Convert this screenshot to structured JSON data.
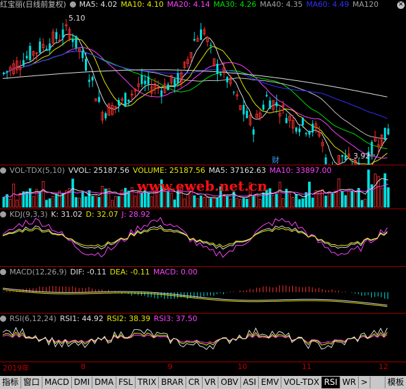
{
  "main": {
    "title": "红宝丽(日线前复权)",
    "ma": [
      {
        "label": "MA5: 4.02",
        "color": "#e0e0e0"
      },
      {
        "label": "MA10: 4.10",
        "color": "#e8e800"
      },
      {
        "label": "MA20: 4.14",
        "color": "#ff40ff"
      },
      {
        "label": "MA30: 4.26",
        "color": "#00e000"
      },
      {
        "label": "MA40: 4.35",
        "color": "#c0c0c0"
      },
      {
        "label": "MA60: 4.49",
        "color": "#3030ff"
      },
      {
        "label": "MA120",
        "color": "#c0c0c0"
      }
    ],
    "high_label": "5.10",
    "low_label": "3.92",
    "cai_label": "财"
  },
  "volume": {
    "items": [
      {
        "label": "VOL-TDX(5,10)",
        "color": "#c0c0c0"
      },
      {
        "label": "VVOL: 25187.56",
        "color": "#e0e0e0"
      },
      {
        "label": "VOLUME: 25187.56",
        "color": "#e8e800"
      },
      {
        "label": "MA5: 37162.63",
        "color": "#e0e0e0"
      },
      {
        "label": "MA10: 33897.00",
        "color": "#ff40ff"
      }
    ]
  },
  "watermark": "www.eweb.net.cn",
  "kdj": {
    "items": [
      {
        "label": "KDJ(9,3,3)",
        "color": "#c0c0c0"
      },
      {
        "label": "K: 31.02",
        "color": "#e0e0e0"
      },
      {
        "label": "D: 32.07",
        "color": "#e8e800"
      },
      {
        "label": "J: 28.92",
        "color": "#ff40ff"
      }
    ]
  },
  "macd": {
    "items": [
      {
        "label": "MACD(12,26,9)",
        "color": "#c0c0c0"
      },
      {
        "label": "DIF: -0.11",
        "color": "#e0e0e0"
      },
      {
        "label": "DEA: -0.11",
        "color": "#e8e800"
      },
      {
        "label": "MACD: 0.00",
        "color": "#ff40ff"
      }
    ]
  },
  "rsi": {
    "items": [
      {
        "label": "RSI(6,12,24)",
        "color": "#c0c0c0"
      },
      {
        "label": "RSI1: 44.92",
        "color": "#e0e0e0"
      },
      {
        "label": "RSI2: 38.39",
        "color": "#e8e800"
      },
      {
        "label": "RSI3: 37.50",
        "color": "#ff40ff"
      }
    ]
  },
  "xaxis": [
    "2019年",
    "8",
    "9",
    "10",
    "11",
    "12"
  ],
  "tabs": [
    "指标",
    "窗口",
    "MACD",
    "DMI",
    "DMA",
    "FSL",
    "TRIX",
    "BRAR",
    "CR",
    "VR",
    "OBV",
    "ASI",
    "EMV",
    "VOL-TDX",
    "RSI",
    "WR",
    ">",
    "模板"
  ],
  "active_tab": "RSI",
  "colors": {
    "up": "#ff3030",
    "down": "#00e0e0",
    "bg": "#000000"
  }
}
